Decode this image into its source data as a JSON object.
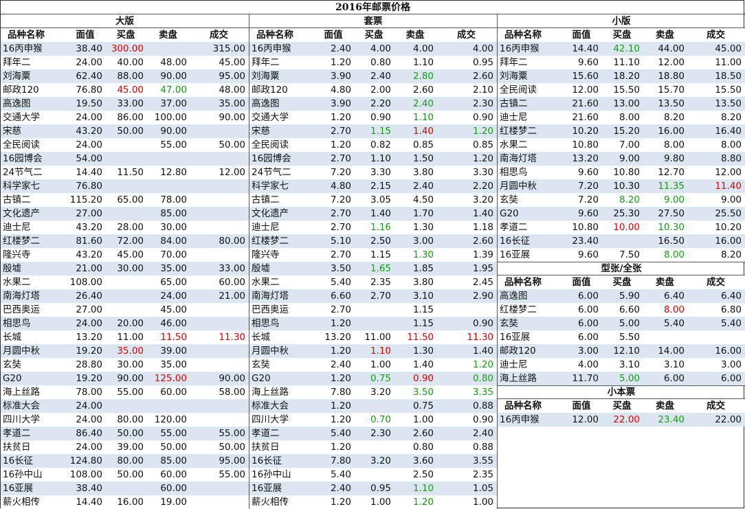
{
  "title": "2016年邮票价格",
  "header": [
    "品种名称",
    "面值",
    "买盘",
    "卖盘",
    "成交"
  ],
  "colors": {
    "alt_row": "#dce6f1",
    "red": "#e00000",
    "green": "#13a013"
  },
  "sections": [
    {
      "id": "large",
      "title": "大版",
      "rows": [
        [
          "16丙申猴",
          "38.40",
          "300.00",
          "",
          "315.00"
        ],
        [
          "拜年二",
          "24.00",
          "40.00",
          "48.00",
          "45.00"
        ],
        [
          "刘海粟",
          "62.40",
          "88.00",
          "90.00",
          "95.00"
        ],
        [
          "邮政120",
          "76.80",
          "45.00",
          "47.00",
          "48.00"
        ],
        [
          "高逸图",
          "19.50",
          "33.00",
          "37.00",
          "35.00"
        ],
        [
          "交通大学",
          "24.00",
          "86.00",
          "100.00",
          "90.00"
        ],
        [
          "宋慈",
          "43.20",
          "50.00",
          "90.00",
          ""
        ],
        [
          "全民阅读",
          "24.00",
          "",
          "55.00",
          "50.00"
        ],
        [
          "16园博会",
          "54.00",
          "",
          "",
          ""
        ],
        [
          "24节气二",
          "14.40",
          "11.50",
          "12.80",
          "12.00"
        ],
        [
          "科学家七",
          "76.80",
          "",
          "",
          ""
        ],
        [
          "古镇二",
          "115.20",
          "65.00",
          "78.00",
          ""
        ],
        [
          "文化遗产",
          "27.00",
          "",
          "85.00",
          ""
        ],
        [
          "迪士尼",
          "43.20",
          "28.00",
          "30.00",
          ""
        ],
        [
          "红楼梦二",
          "81.60",
          "72.00",
          "84.00",
          "80.00"
        ],
        [
          "隆兴寺",
          "43.20",
          "45.00",
          "70.00",
          ""
        ],
        [
          "殷墟",
          "21.00",
          "30.00",
          "35.00",
          "33.00"
        ],
        [
          "水果二",
          "108.00",
          "",
          "65.00",
          "60.00"
        ],
        [
          "南海灯塔",
          "26.40",
          "",
          "24.00",
          "21.00"
        ],
        [
          "巴西奥运",
          "27.00",
          "",
          "45.00",
          ""
        ],
        [
          "相思鸟",
          "24.00",
          "20.00",
          "46.00",
          ""
        ],
        [
          "长城",
          "13.20",
          "11.00",
          "11.50",
          "11.30"
        ],
        [
          "月圆中秋",
          "19.20",
          "35.00",
          "39.00",
          ""
        ],
        [
          "玄奘",
          "28.80",
          "30.00",
          "35.00",
          ""
        ],
        [
          "G20",
          "19.20",
          "90.00",
          "125.00",
          "90.00"
        ],
        [
          "海上丝路",
          "78.00",
          "55.00",
          "60.00",
          "58.00"
        ],
        [
          "标准大会",
          "24.00",
          "",
          "",
          ""
        ],
        [
          "四川大学",
          "24.00",
          "80.00",
          "120.00",
          ""
        ],
        [
          "孝道二",
          "86.40",
          "50.00",
          "55.00",
          "55.00"
        ],
        [
          "扶贫日",
          "24.00",
          "39.00",
          "50.00",
          "50.00"
        ],
        [
          "16长征",
          "124.80",
          "80.00",
          "85.00",
          "95.00"
        ],
        [
          "16孙中山",
          "108.00",
          "50.00",
          "60.00",
          "55.00"
        ],
        [
          "16亚展",
          "38.40",
          "",
          "60.00",
          ""
        ],
        [
          "薪火相传",
          "14.40",
          "16.00",
          "19.00",
          ""
        ]
      ],
      "colored": {
        "0-2": "red",
        "3-2": "red",
        "3-3": "green",
        "21-3": "red",
        "21-4": "red",
        "22-2": "red",
        "24-3": "red"
      }
    },
    {
      "id": "set",
      "title": "套票",
      "rows": [
        [
          "16丙申猴",
          "2.40",
          "4.00",
          "4.00",
          "4.00"
        ],
        [
          "拜年二",
          "1.20",
          "0.80",
          "1.10",
          "0.95"
        ],
        [
          "刘海粟",
          "3.90",
          "2.40",
          "2.80",
          "2.60"
        ],
        [
          "邮政120",
          "4.80",
          "2.00",
          "2.60",
          "2.10"
        ],
        [
          "高逸图",
          "3.90",
          "2.20",
          "2.40",
          "2.30"
        ],
        [
          "交通大学",
          "1.20",
          "0.90",
          "1.10",
          "0.90"
        ],
        [
          "宋慈",
          "2.70",
          "1.15",
          "1.40",
          "1.20"
        ],
        [
          "全民阅读",
          "1.20",
          "0.82",
          "0.85",
          "0.85"
        ],
        [
          "16园博会",
          "2.70",
          "1.10",
          "1.50",
          "1.20"
        ],
        [
          "24节气二",
          "7.20",
          "3.30",
          "3.80",
          "3.30"
        ],
        [
          "科学家七",
          "4.80",
          "2.15",
          "2.40",
          "2.20"
        ],
        [
          "古镇二",
          "7.20",
          "3.05",
          "4.50",
          "3.20"
        ],
        [
          "文化遗产",
          "2.70",
          "1.40",
          "1.70",
          "1.40"
        ],
        [
          "迪士尼",
          "2.70",
          "1.16",
          "1.30",
          "1.18"
        ],
        [
          "红楼梦二",
          "5.10",
          "2.50",
          "3.00",
          "2.60"
        ],
        [
          "隆兴寺",
          "2.70",
          "1.15",
          "1.30",
          "1.39"
        ],
        [
          "殷墟",
          "3.50",
          "1.65",
          "1.85",
          "1.95"
        ],
        [
          "水果二",
          "5.40",
          "2.35",
          "3.80",
          "2.45"
        ],
        [
          "南海灯塔",
          "6.60",
          "2.70",
          "3.10",
          "2.90"
        ],
        [
          "巴西奥运",
          "2.70",
          "",
          "1.15",
          ""
        ],
        [
          "相思鸟",
          "1.20",
          "",
          "1.15",
          "0.90"
        ],
        [
          "长城",
          "13.20",
          "11.00",
          "11.50",
          "11.30"
        ],
        [
          "月圆中秋",
          "1.20",
          "1.10",
          "1.30",
          "1.40"
        ],
        [
          "玄奘",
          "2.40",
          "1.00",
          "1.40",
          "1.20"
        ],
        [
          "G20",
          "1.20",
          "0.75",
          "0.90",
          "0.80"
        ],
        [
          "海上丝路",
          "7.80",
          "3.20",
          "3.50",
          "3.35"
        ],
        [
          "标准大会",
          "1.20",
          "",
          "0.75",
          "0.88"
        ],
        [
          "四川大学",
          "1.20",
          "0.70",
          "1.00",
          "0.90"
        ],
        [
          "孝道二",
          "5.40",
          "2.30",
          "2.60",
          "2.40"
        ],
        [
          "扶贫日",
          "1.20",
          "",
          "0.80",
          "0.88"
        ],
        [
          "16长征",
          "7.80",
          "3.20",
          "3.60",
          "3.55"
        ],
        [
          "16孙中山",
          "5.40",
          "",
          "2.50",
          "2.35"
        ],
        [
          "16亚展",
          "2.40",
          "0.95",
          "1.10",
          "1.05"
        ],
        [
          "薪火相传",
          "1.20",
          "1.00",
          "1.20",
          "1.00"
        ]
      ],
      "colored": {
        "2-3": "green",
        "4-3": "green",
        "5-3": "green",
        "6-2": "green",
        "6-3": "red",
        "6-4": "green",
        "13-2": "green",
        "15-3": "green",
        "16-2": "green",
        "21-3": "red",
        "21-4": "red",
        "22-2": "red",
        "23-4": "green",
        "24-2": "green",
        "24-3": "red",
        "24-4": "green",
        "25-3": "green",
        "25-4": "green",
        "27-2": "green",
        "32-3": "green",
        "33-3": "green"
      }
    },
    {
      "id": "small",
      "title": "小版",
      "rows": [
        [
          "16丙申猴",
          "14.40",
          "42.10",
          "44.00",
          "45.00"
        ],
        [
          "拜年二",
          "9.60",
          "11.10",
          "12.00",
          "11.00"
        ],
        [
          "刘海粟",
          "15.60",
          "18.20",
          "18.80",
          "18.50"
        ],
        [
          "全民阅读",
          "12.00",
          "15.50",
          "15.70",
          "15.50"
        ],
        [
          "古镇二",
          "21.60",
          "13.00",
          "13.50",
          "13.50"
        ],
        [
          "迪士尼",
          "21.60",
          "8.00",
          "8.20",
          "8.20"
        ],
        [
          "红楼梦二",
          "10.20",
          "15.20",
          "16.00",
          "16.40"
        ],
        [
          "水果二",
          "10.80",
          "7.00",
          "8.00",
          "8.00"
        ],
        [
          "南海灯塔",
          "13.20",
          "9.00",
          "9.80",
          "8.80"
        ],
        [
          "相思鸟",
          "9.60",
          "10.80",
          "12.70",
          "12.00"
        ],
        [
          "月圆中秋",
          "7.20",
          "10.30",
          "11.35",
          "11.40"
        ],
        [
          "玄奘",
          "7.20",
          "8.20",
          "9.00",
          "9.00"
        ],
        [
          "G20",
          "9.60",
          "25.30",
          "27.50",
          "25.50"
        ],
        [
          "孝道二",
          "10.80",
          "10.00",
          "10.30",
          "10.20"
        ],
        [
          "16长征",
          "23.40",
          "",
          "16.50",
          "16.00"
        ],
        [
          "16亚展",
          "9.60",
          "7.50",
          "8.00",
          "8.20"
        ]
      ],
      "colored": {
        "0-2": "green",
        "10-3": "green",
        "10-4": "red",
        "11-2": "green",
        "11-3": "green",
        "13-2": "red",
        "13-3": "green",
        "15-3": "green"
      }
    },
    {
      "id": "sheet",
      "title": "型张/全张",
      "rows": [
        [
          "高逸图",
          "6.00",
          "5.90",
          "6.40",
          "6.40"
        ],
        [
          "红楼梦二",
          "6.00",
          "6.60",
          "8.00",
          "6.80"
        ],
        [
          "玄奘",
          "6.00",
          "5.00",
          "5.40",
          "5.40"
        ],
        [
          "16亚展",
          "6.00",
          "5.50",
          "",
          ""
        ],
        [
          "邮政120",
          "3.00",
          "12.10",
          "14.00",
          "16.00"
        ],
        [
          "迪士尼",
          "4.00",
          "3.10",
          "3.10",
          "3.00"
        ],
        [
          "海上丝路",
          "11.70",
          "5.00",
          "6.00",
          "6.00"
        ]
      ],
      "colored": {
        "1-3": "red",
        "6-2": "green"
      }
    },
    {
      "id": "booklet",
      "title": "小本票",
      "rows": [
        [
          "16丙申猴",
          "12.00",
          "22.00",
          "23.40",
          "22.00"
        ]
      ],
      "colored": {
        "0-2": "red",
        "0-3": "green"
      }
    }
  ]
}
